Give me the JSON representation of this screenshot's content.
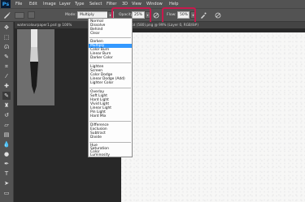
{
  "app": {
    "logo": "Ps"
  },
  "menubar": [
    "File",
    "Edit",
    "Image",
    "Layer",
    "Type",
    "Select",
    "Filter",
    "3D",
    "View",
    "Window",
    "Help"
  ],
  "options": {
    "mode_label": "Mode:",
    "mode_value": "Multiply",
    "opacity_label": "Opacity:",
    "opacity_value": "25%",
    "flow_label": "Flow:",
    "flow_value": "50%",
    "highlight_color": "#c8194d"
  },
  "tabs": [
    {
      "label": "watercolourpaper1.psd @ 100%"
    },
    {
      "label": "Screenshot (580).png @ 99% (Layer 0, RGB/8#)"
    }
  ],
  "blend_modes": [
    [
      "Normal",
      "Dissolve",
      "Behind",
      "Clear"
    ],
    [
      "Darken",
      "Multiply",
      "Color Burn",
      "Linear Burn",
      "Darker Color"
    ],
    [
      "Lighten",
      "Screen",
      "Color Dodge",
      "Linear Dodge (Add)",
      "Lighter Color"
    ],
    [
      "Overlay",
      "Soft Light",
      "Hard Light",
      "Vivid Light",
      "Linear Light",
      "Pin Light",
      "Hard Mix"
    ],
    [
      "Difference",
      "Exclusion",
      "Subtract",
      "Divide"
    ],
    [
      "Hue",
      "Saturation",
      "Color",
      "Luminosity"
    ]
  ],
  "selected_mode": "Multiply"
}
